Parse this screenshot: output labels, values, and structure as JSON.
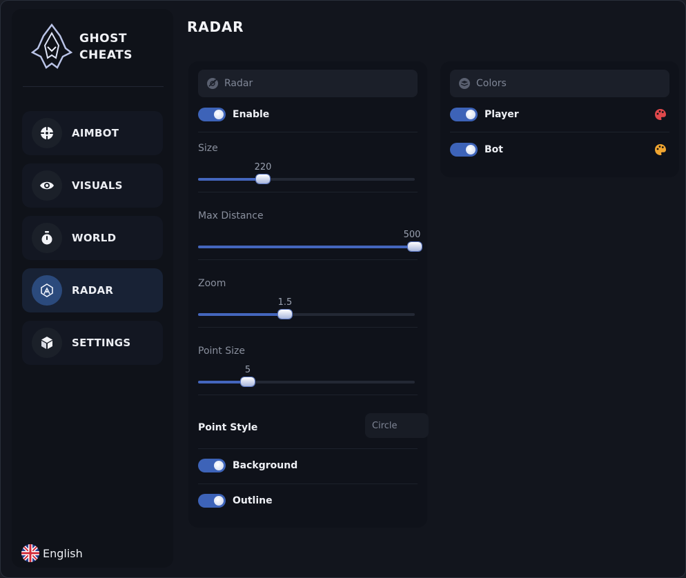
{
  "brand": {
    "line1": "GHOST",
    "line2": "CHEATS"
  },
  "nav": {
    "items": [
      {
        "label": "AIMBOT",
        "icon": "crosshair-icon",
        "active": false
      },
      {
        "label": "VISUALS",
        "icon": "eye-icon",
        "active": false
      },
      {
        "label": "WORLD",
        "icon": "stopwatch-icon",
        "active": false
      },
      {
        "label": "RADAR",
        "icon": "radar-icon",
        "active": true
      },
      {
        "label": "SETTINGS",
        "icon": "cube-icon",
        "active": false
      }
    ]
  },
  "language": {
    "label": "English",
    "icon": "uk-flag-icon"
  },
  "page": {
    "title": "RADAR"
  },
  "radar_panel": {
    "header": "Radar",
    "enable": {
      "label": "Enable",
      "on": true
    },
    "sliders": [
      {
        "label": "Size",
        "value": "220",
        "fraction": 0.3
      },
      {
        "label": "Max Distance",
        "value": "500",
        "fraction": 1.0
      },
      {
        "label": "Zoom",
        "value": "1.5",
        "fraction": 0.4
      },
      {
        "label": "Point Size",
        "value": "5",
        "fraction": 0.23
      }
    ],
    "point_style": {
      "label": "Point Style",
      "value": "Circle"
    },
    "background": {
      "label": "Background",
      "on": true
    },
    "outline": {
      "label": "Outline",
      "on": true
    }
  },
  "colors_panel": {
    "header": "Colors",
    "items": [
      {
        "label": "Player",
        "on": true,
        "color": "#e0484b"
      },
      {
        "label": "Bot",
        "on": true,
        "color": "#f0a530"
      }
    ]
  },
  "theme": {
    "accent": "#3d63b8",
    "active_nav": "#2b4a7c"
  }
}
